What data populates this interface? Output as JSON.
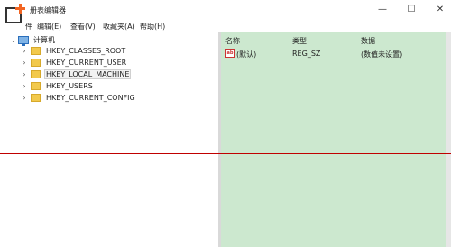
{
  "window": {
    "title": "册表编辑器",
    "controls": {
      "minimize": "—",
      "maximize": "☐",
      "close": "✕"
    }
  },
  "menu": [
    {
      "label": "编辑(E)"
    },
    {
      "label": "查看(V)"
    },
    {
      "label": "收藏夹(A)"
    },
    {
      "label": "帮助(H)"
    }
  ],
  "menu_partial": "件",
  "tree": {
    "root": "计算机",
    "nodes": [
      {
        "label": "HKEY_CLASSES_ROOT"
      },
      {
        "label": "HKEY_CURRENT_USER"
      },
      {
        "label": "HKEY_LOCAL_MACHINE"
      },
      {
        "label": "HKEY_USERS"
      },
      {
        "label": "HKEY_CURRENT_CONFIG"
      }
    ],
    "selected_index": 2
  },
  "list": {
    "columns": [
      "名称",
      "类型",
      "数据"
    ],
    "rows": [
      {
        "name": "(默认)",
        "type": "REG_SZ",
        "data": "(数值未设置)",
        "icon": "ab"
      }
    ]
  },
  "colors": {
    "list_background": "#cce8cf",
    "separator_line": "#c00000",
    "logo_accent": "#f26522"
  },
  "icons": [
    "app-logo-icon",
    "computer-icon",
    "folder-icon",
    "string-value-icon"
  ]
}
